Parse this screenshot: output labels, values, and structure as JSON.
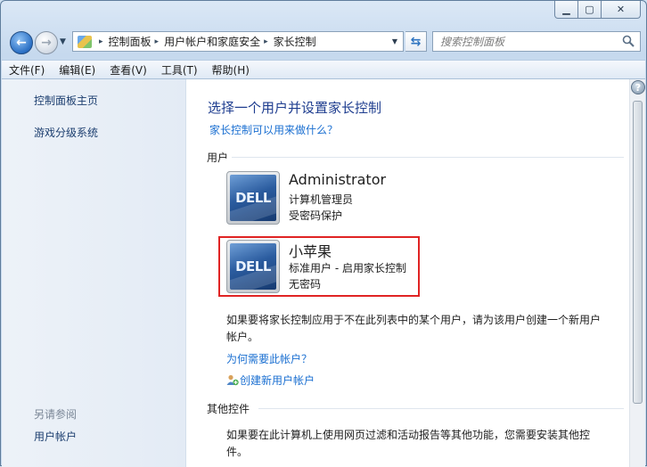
{
  "window": {
    "controls": {
      "minimize": "▁",
      "maximize": "▢",
      "close": "✕"
    }
  },
  "nav": {
    "breadcrumbs": [
      "控制面板",
      "用户帐户和家庭安全",
      "家长控制"
    ],
    "search_placeholder": "搜索控制面板"
  },
  "menu": [
    "文件(F)",
    "编辑(E)",
    "查看(V)",
    "工具(T)",
    "帮助(H)"
  ],
  "sidebar": {
    "links": [
      "控制面板主页",
      "游戏分级系统"
    ],
    "see_also_title": "另请参阅",
    "see_also_links": [
      "用户帐户"
    ]
  },
  "main": {
    "title": "选择一个用户并设置家长控制",
    "help_link": "家长控制可以用来做什么？",
    "users_section": "用户",
    "users": [
      {
        "name": "Administrator",
        "role": "计算机管理员",
        "password": "受密码保护",
        "avatar_text": "DELL"
      },
      {
        "name": "小苹果",
        "role": "标准用户 - 启用家长控制",
        "password": "无密码",
        "avatar_text": "DELL"
      }
    ],
    "note": "如果要将家长控制应用于不在此列表中的某个用户，请为该用户创建一个新用户帐户。",
    "why_link": "为何需要此帐户？",
    "create_link": "创建新用户帐户",
    "other_section": "其他控件",
    "other_note": "如果要在此计算机上使用网页过滤和活动报告等其他功能，您需要安装其他控件。"
  },
  "colors": {
    "highlight": "#e02424",
    "link": "#1a6fd1",
    "title": "#1e3d8f"
  },
  "icons": {
    "back": "back-arrow-icon",
    "forward": "forward-arrow-icon",
    "refresh": "refresh-icon",
    "search": "search-icon",
    "help": "help-icon"
  }
}
